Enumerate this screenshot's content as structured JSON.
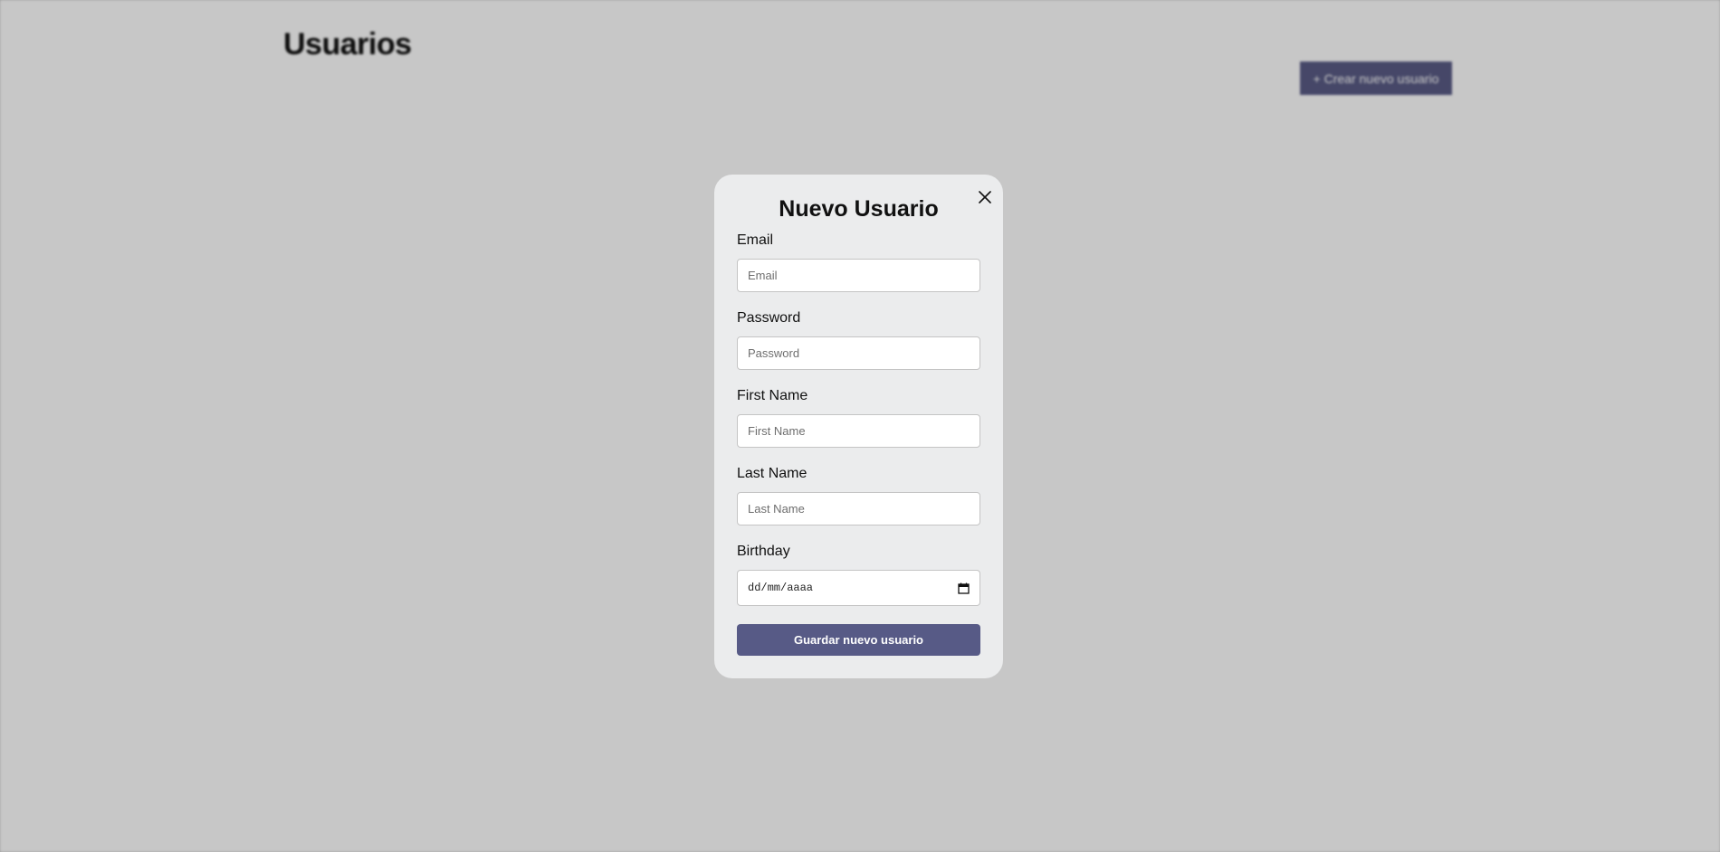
{
  "page": {
    "title": "Usuarios",
    "create_button_label": "+ Crear nuevo usuario"
  },
  "modal": {
    "title": "Nuevo Usuario",
    "close_icon": "close-icon",
    "fields": {
      "email": {
        "label": "Email",
        "placeholder": "Email",
        "value": ""
      },
      "password": {
        "label": "Password",
        "placeholder": "Password",
        "value": ""
      },
      "first_name": {
        "label": "First Name",
        "placeholder": "First Name",
        "value": ""
      },
      "last_name": {
        "label": "Last Name",
        "placeholder": "Last Name",
        "value": ""
      },
      "birthday": {
        "label": "Birthday",
        "placeholder": "dd/mm/aaaa",
        "calendar_icon": "calendar-icon"
      }
    },
    "save_button_label": "Guardar nuevo usuario"
  },
  "colors": {
    "accent": "#575a86",
    "backdrop": "#c8c8c8",
    "modal_background": "#ebeced"
  }
}
